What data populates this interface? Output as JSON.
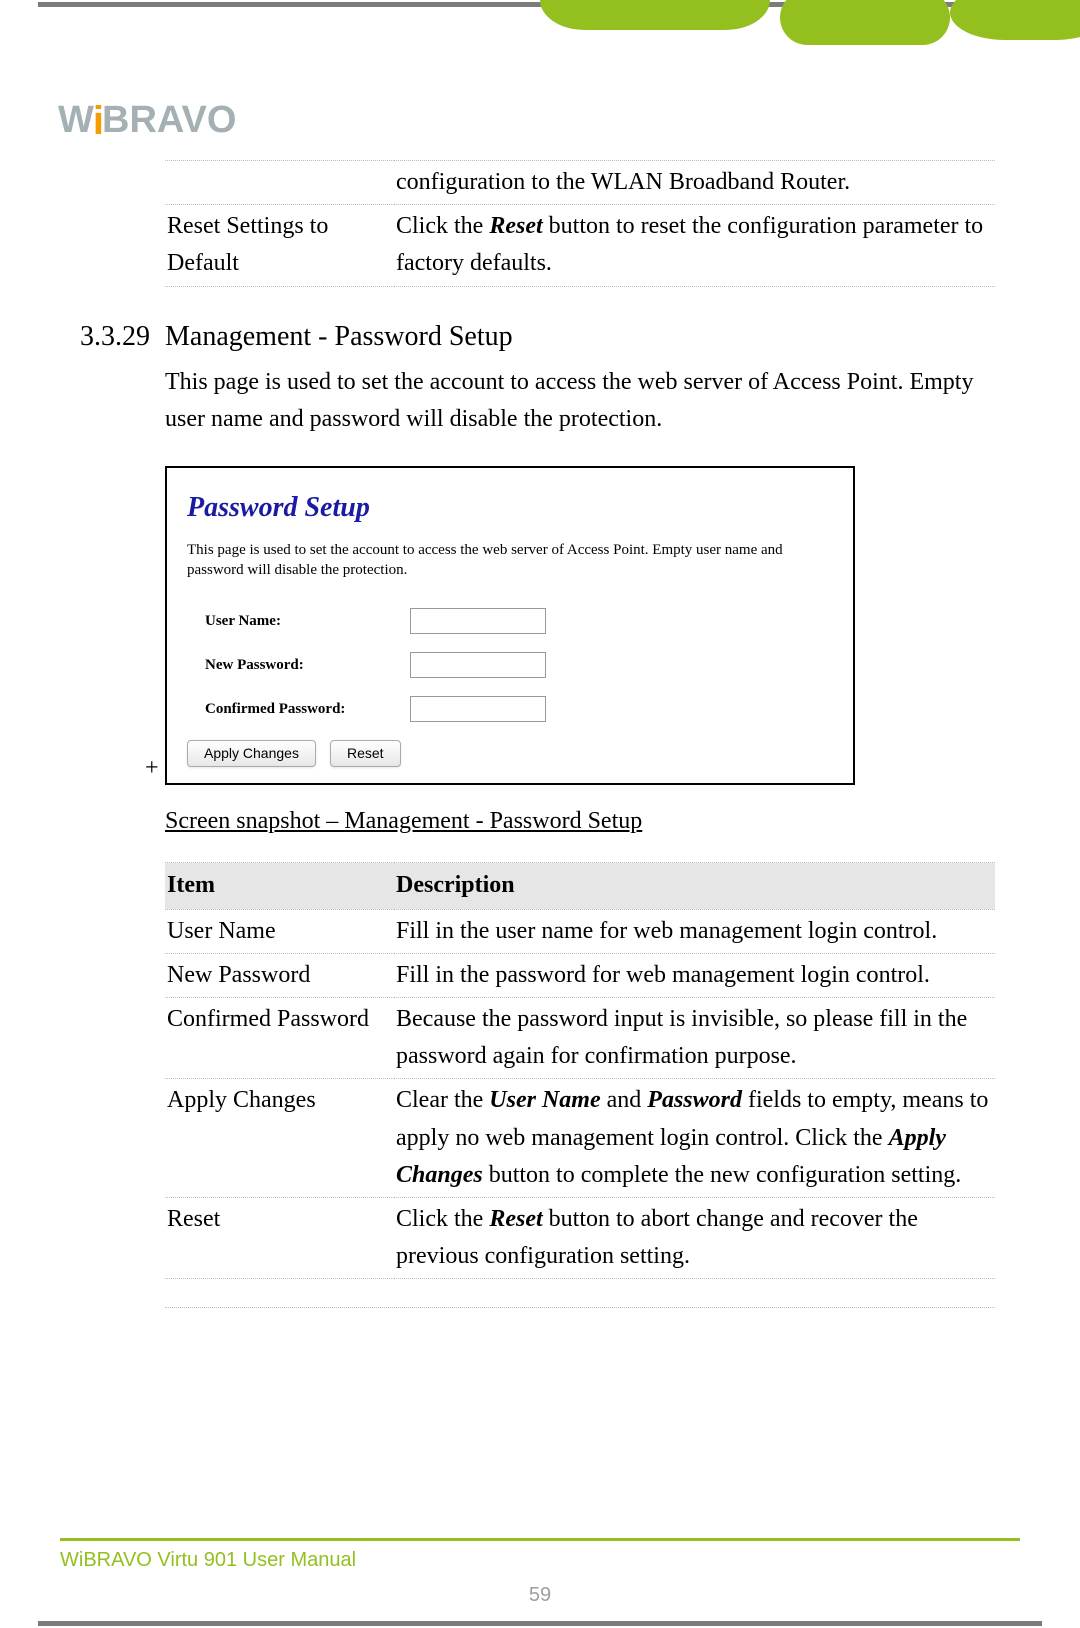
{
  "brand_parts": {
    "a": "W",
    "i": "i",
    "b": "BRAVO"
  },
  "top_table": {
    "frag": "configuration to the WLAN Broadband Router.",
    "r2_item": "Reset Settings to Default",
    "r2_desc_a": "Click the ",
    "r2_desc_b": "Reset",
    "r2_desc_c": " button to reset the configuration parameter to factory defaults."
  },
  "section": {
    "no": "3.3.29",
    "title": "Management - Password Setup",
    "intro": "This page is used to set the account to access the web server of Access Point. Empty user name and password will disable the protection."
  },
  "snapshot": {
    "title": "Password Setup",
    "desc": "This page is used to set the account to access the web server of Access Point. Empty user name and password will disable the protection.",
    "f1": "User Name:",
    "f2": "New Password:",
    "f3": "Confirmed Password:",
    "btn_apply": "Apply Changes",
    "btn_reset": "Reset",
    "mark": "+"
  },
  "caption": "Screen snapshot – Management - Password Setup",
  "tbl": {
    "h1": "Item",
    "h2": "Description",
    "rows": [
      {
        "i": "User Name",
        "d": "Fill in the user name for web management login control."
      },
      {
        "i": "New Password",
        "d": "Fill in the password for web management login control."
      },
      {
        "i": "Confirmed Password",
        "d": "Because the password input is invisible, so please fill in the password again for confirmation purpose."
      }
    ],
    "apply": {
      "i": "Apply Changes",
      "d1": "Clear the ",
      "b1": "User Name",
      "d2": " and ",
      "b2": "Password",
      "d3": " fields to empty, means to apply no web management login control. Click the ",
      "b3": "Apply Changes",
      "d4": " button to complete the new configuration setting."
    },
    "reset": {
      "i": "Reset",
      "d1": "Click the ",
      "b1": "Reset",
      "d2": " button to abort change and recover the previous configuration setting."
    }
  },
  "footer": "WiBRAVO Virtu 901 User Manual",
  "pagenum": "59"
}
